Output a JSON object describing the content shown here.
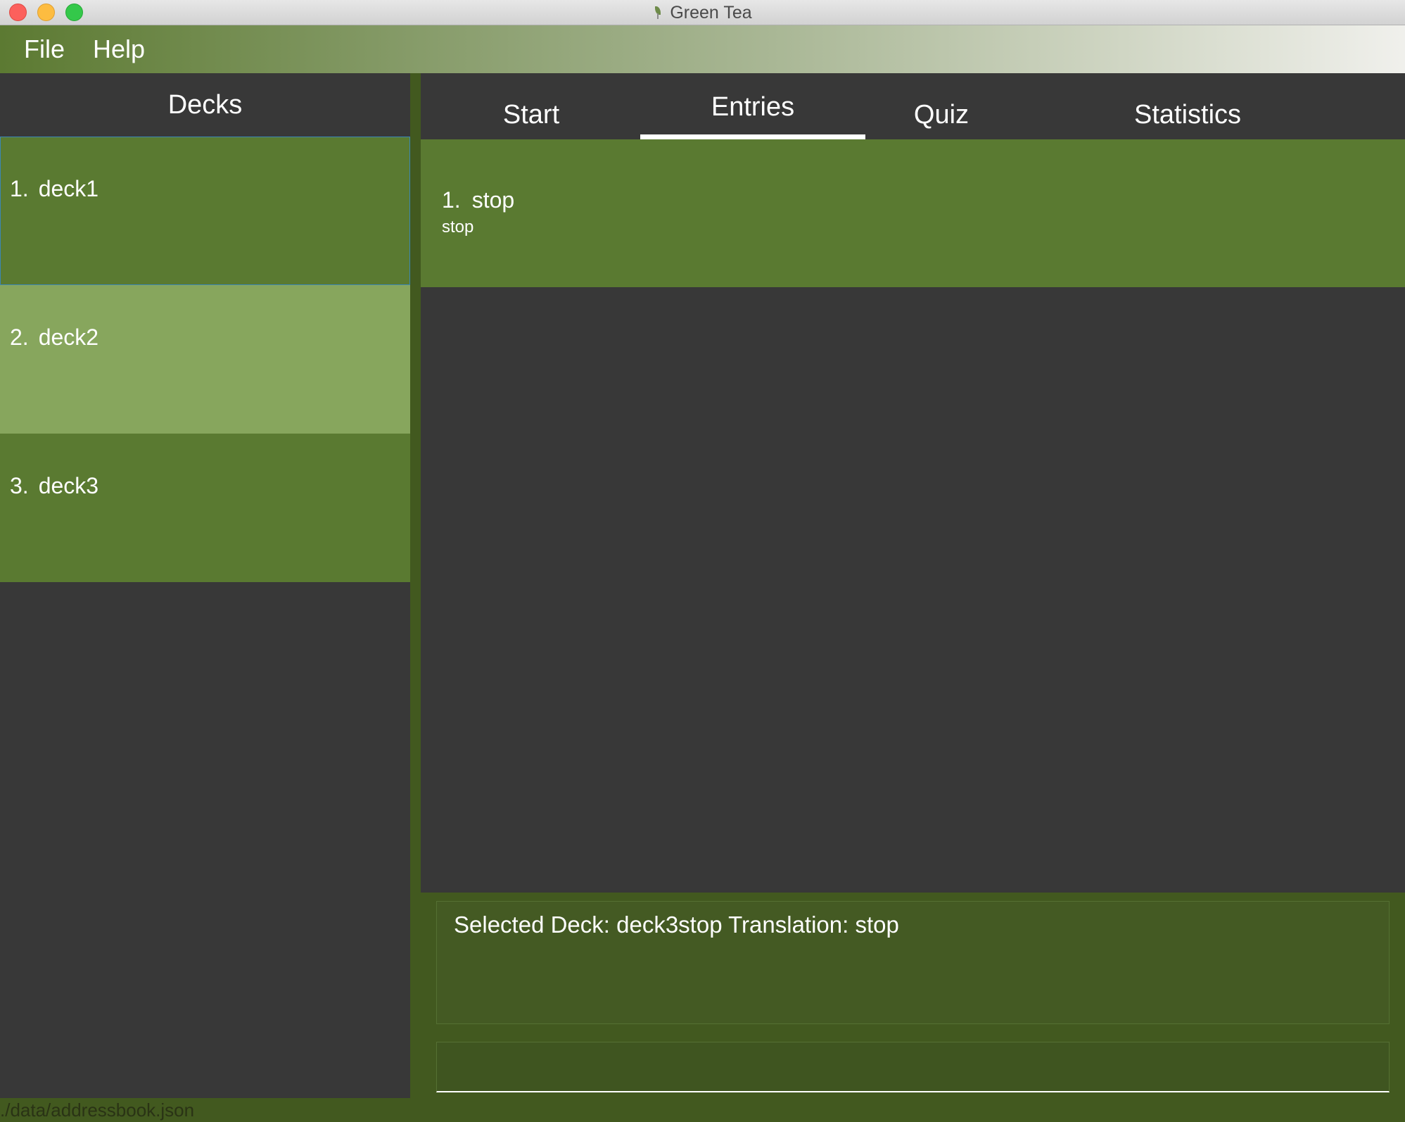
{
  "window": {
    "title": "Green Tea",
    "app_icon": "leaf-icon"
  },
  "menu": {
    "items": [
      {
        "label": "File"
      },
      {
        "label": "Help"
      }
    ]
  },
  "decks": {
    "header": "Decks",
    "items": [
      {
        "index": "1.",
        "name": "deck1",
        "state": "selected"
      },
      {
        "index": "2.",
        "name": "deck2",
        "state": "hover"
      },
      {
        "index": "3.",
        "name": "deck3",
        "state": "normal"
      }
    ]
  },
  "tabs": {
    "items": [
      {
        "label": "Start"
      },
      {
        "label": "Entries",
        "active": true
      },
      {
        "label": "Quiz"
      },
      {
        "label": "Statistics"
      }
    ]
  },
  "entries": {
    "items": [
      {
        "index": "1.",
        "word": "stop",
        "translation": "stop"
      }
    ]
  },
  "result": {
    "text": "Selected Deck: deck3stop Translation: stop"
  },
  "command": {
    "value": "",
    "placeholder": ""
  },
  "status": {
    "path": "./data/addressbook.json"
  },
  "colors": {
    "card_green": "#5a7a31",
    "card_hover": "#87a65d",
    "panel_dark": "#383838",
    "divider_green": "#42591f",
    "selection_border": "#3b87b5"
  }
}
